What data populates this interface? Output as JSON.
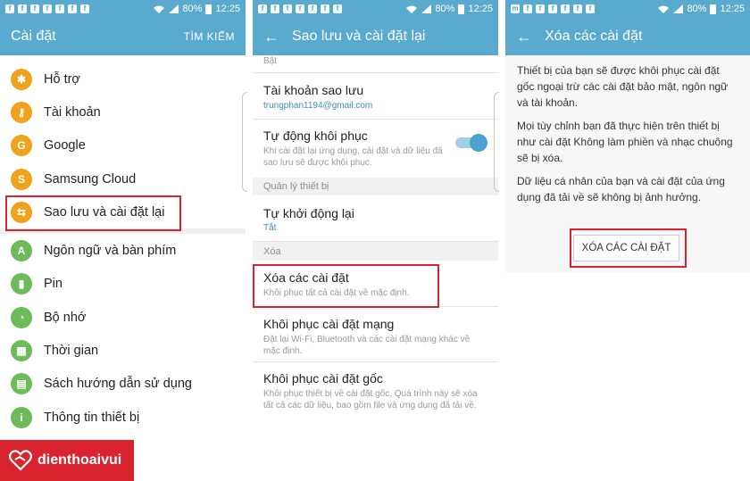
{
  "status": {
    "battery": "80%",
    "time": "12:25"
  },
  "panel1": {
    "title": "Cài đặt",
    "search": "TÌM KIẾM",
    "items": [
      {
        "label": "Hỗ trợ",
        "icon": "accessibility-icon",
        "color": "#f0a21c"
      },
      {
        "label": "Tài khoản",
        "icon": "key-icon",
        "color": "#f0a21c"
      },
      {
        "label": "Google",
        "icon": "google-icon",
        "color": "#f0a21c"
      },
      {
        "label": "Samsung Cloud",
        "icon": "samsung-cloud-icon",
        "color": "#f0a21c"
      },
      {
        "label": "Sao lưu và cài đặt lại",
        "icon": "backup-icon",
        "color": "#f0a21c"
      },
      {
        "label": "Ngôn ngữ và bàn phím",
        "icon": "language-icon",
        "color": "#6dbb5a"
      },
      {
        "label": "Pin",
        "icon": "battery-icon",
        "color": "#6dbb5a"
      },
      {
        "label": "Bộ nhớ",
        "icon": "memory-icon",
        "color": "#6dbb5a"
      },
      {
        "label": "Thời gian",
        "icon": "calendar-icon",
        "color": "#6dbb5a"
      },
      {
        "label": "Sách hướng dẫn sử dụng",
        "icon": "manual-icon",
        "color": "#6dbb5a"
      },
      {
        "label": "Thông tin thiết bị",
        "icon": "info-icon",
        "color": "#6dbb5a"
      }
    ]
  },
  "panel2": {
    "title": "Sao lưu và cài đặt lại",
    "top_fragment": "Bật",
    "backup_account": {
      "title": "Tài khoản sao lưu",
      "email": "trungphan1194@gmail.com"
    },
    "auto_restore": {
      "title": "Tự động khôi phục",
      "desc": "Khi cài đặt lại ứng dụng, cài đặt và dữ liệu đã sao lưu sẽ được khôi phục.",
      "on": true
    },
    "section_device": "Quản lý thiết bị",
    "auto_restart": {
      "title": "Tự khởi động lại",
      "value": "Tắt"
    },
    "section_reset": "Xóa",
    "reset_settings": {
      "title": "Xóa các cài đặt",
      "desc": "Khôi phục tất cả cài đặt về mặc định."
    },
    "reset_network": {
      "title": "Khôi phục cài đặt mạng",
      "desc": "Đặt lại Wi-Fi, Bluetooth và các cài đặt mạng khác về mặc định."
    },
    "factory_reset": {
      "title": "Khôi phục cài đặt gốc",
      "desc": "Khôi phục thiết bị về cài đặt gốc. Quá trình này sẽ xóa tất cả các dữ liệu, bao gồm file và ứng dụng đã tải về."
    }
  },
  "panel3": {
    "title": "Xóa các cài đặt",
    "p1": "Thiết bị của bạn sẽ được khôi phục cài đặt gốc ngoại trừ các cài đặt bảo mật, ngôn ngữ và tài khoản.",
    "p2": "Mọi tùy chỉnh bạn đã thực hiện trên thiết bị như cài đặt Không làm phiền và nhạc chuông sẽ bị xóa.",
    "p3": "Dữ liệu cá nhân của bạn và cài đặt của ứng dụng đã tải về sẽ không bị ảnh hưởng.",
    "button": "XÓA CÁC CÀI ĐẶT"
  },
  "brand": "dienthoaivui"
}
